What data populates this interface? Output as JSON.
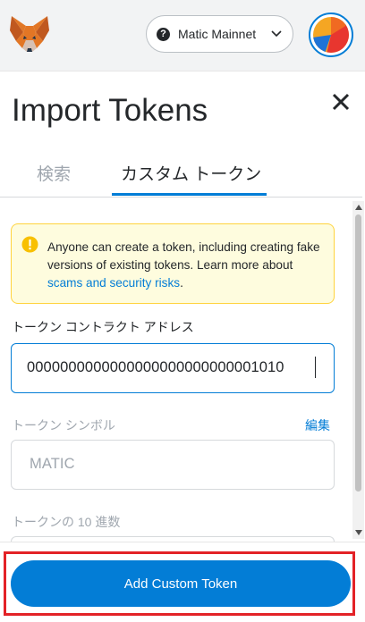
{
  "network": {
    "label": "Matic Mainnet",
    "icon": "help-icon",
    "icon_glyph": "?"
  },
  "page": {
    "title": "Import Tokens"
  },
  "tabs": {
    "search": "検索",
    "custom": "カスタム トークン"
  },
  "warning": {
    "text": "Anyone can create a token, including creating fake versions of existing tokens. Learn more about ",
    "link": "scams and security risks",
    "suffix": "."
  },
  "fields": {
    "address_label": "トークン コントラクト アドレス",
    "address_value": "0000000000000000000000000001010",
    "symbol_label": "トークン シンボル",
    "symbol_edit": "編集",
    "symbol_placeholder": "MATIC",
    "decimals_label": "トークンの 10 進数"
  },
  "footer": {
    "add_button": "Add Custom Token"
  },
  "colors": {
    "accent": "#037dd6",
    "warning_border": "#ffd33d",
    "warning_bg": "#fefcde",
    "highlight": "#e32227"
  }
}
